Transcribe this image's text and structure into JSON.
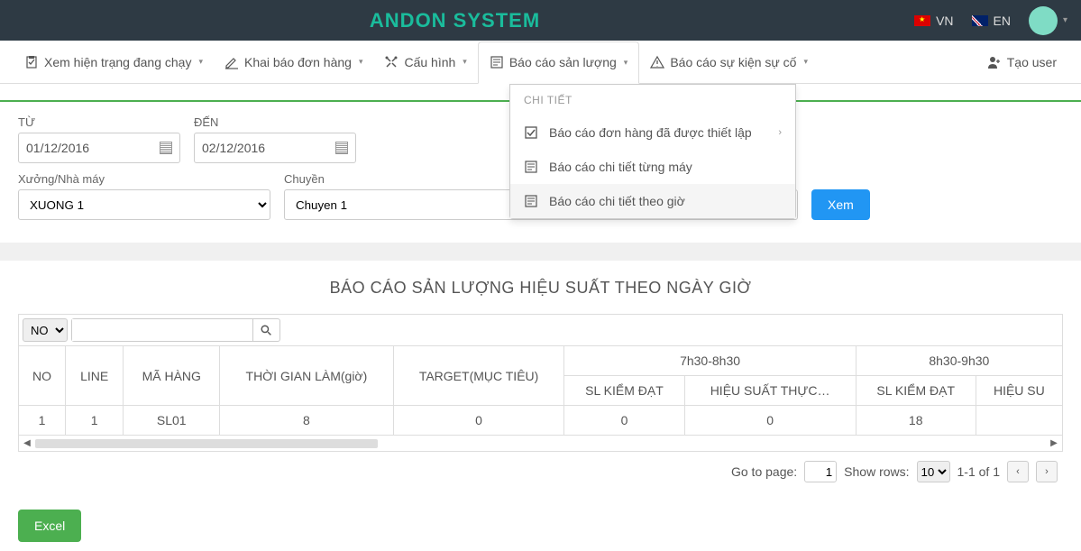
{
  "header": {
    "title": "ANDON SYSTEM",
    "lang_vn": "VN",
    "lang_en": "EN"
  },
  "nav": {
    "items": [
      "Xem hiện trạng đang chạy",
      "Khai báo đơn hàng",
      "Cấu hình",
      "Báo cáo sản lượng",
      "Báo cáo sự kiện sự cố"
    ],
    "create_user": "Tạo user"
  },
  "dropdown": {
    "header": "CHI TIẾT",
    "items": [
      "Báo cáo đơn hàng đã được thiết lập",
      "Báo cáo chi tiết từng máy",
      "Báo cáo chi tiết theo giờ"
    ]
  },
  "filters": {
    "from_label": "TỪ",
    "from_value": "01/12/2016",
    "to_label": "ĐẾN",
    "to_value": "02/12/2016",
    "factory_label": "Xưởng/Nhà máy",
    "factory_value": "XUONG 1",
    "line_label": "Chuyền",
    "line_value": "Chuyen 1",
    "view_btn": "Xem"
  },
  "report": {
    "title": "BÁO CÁO SẢN LƯỢNG HIỆU SUẤT THEO NGÀY GIỜ",
    "filter_option": "NO",
    "columns": {
      "no": "NO",
      "line": "LINE",
      "ma_hang": "MÃ HÀNG",
      "thoi_gian": "THỜI GIAN LÀM(giờ)",
      "target": "TARGET(MỤC TIÊU)",
      "period1": "7h30-8h30",
      "period2": "8h30-9h30",
      "sl_kiem_dat": "SL KIỂM ĐẠT",
      "hieu_suat": "HIỆU SUẤT THỰC…",
      "hieu_suat2": "HIỆU SU"
    },
    "row": {
      "no": "1",
      "line": "1",
      "ma_hang": "SL01",
      "thoi_gian": "8",
      "target": "0",
      "p1_sl": "0",
      "p1_hs": "0",
      "p2_sl": "18"
    },
    "pager": {
      "goto_label": "Go to page:",
      "goto_value": "1",
      "show_label": "Show rows:",
      "show_value": "10",
      "range": "1-1 of 1"
    },
    "excel_btn": "Excel"
  }
}
